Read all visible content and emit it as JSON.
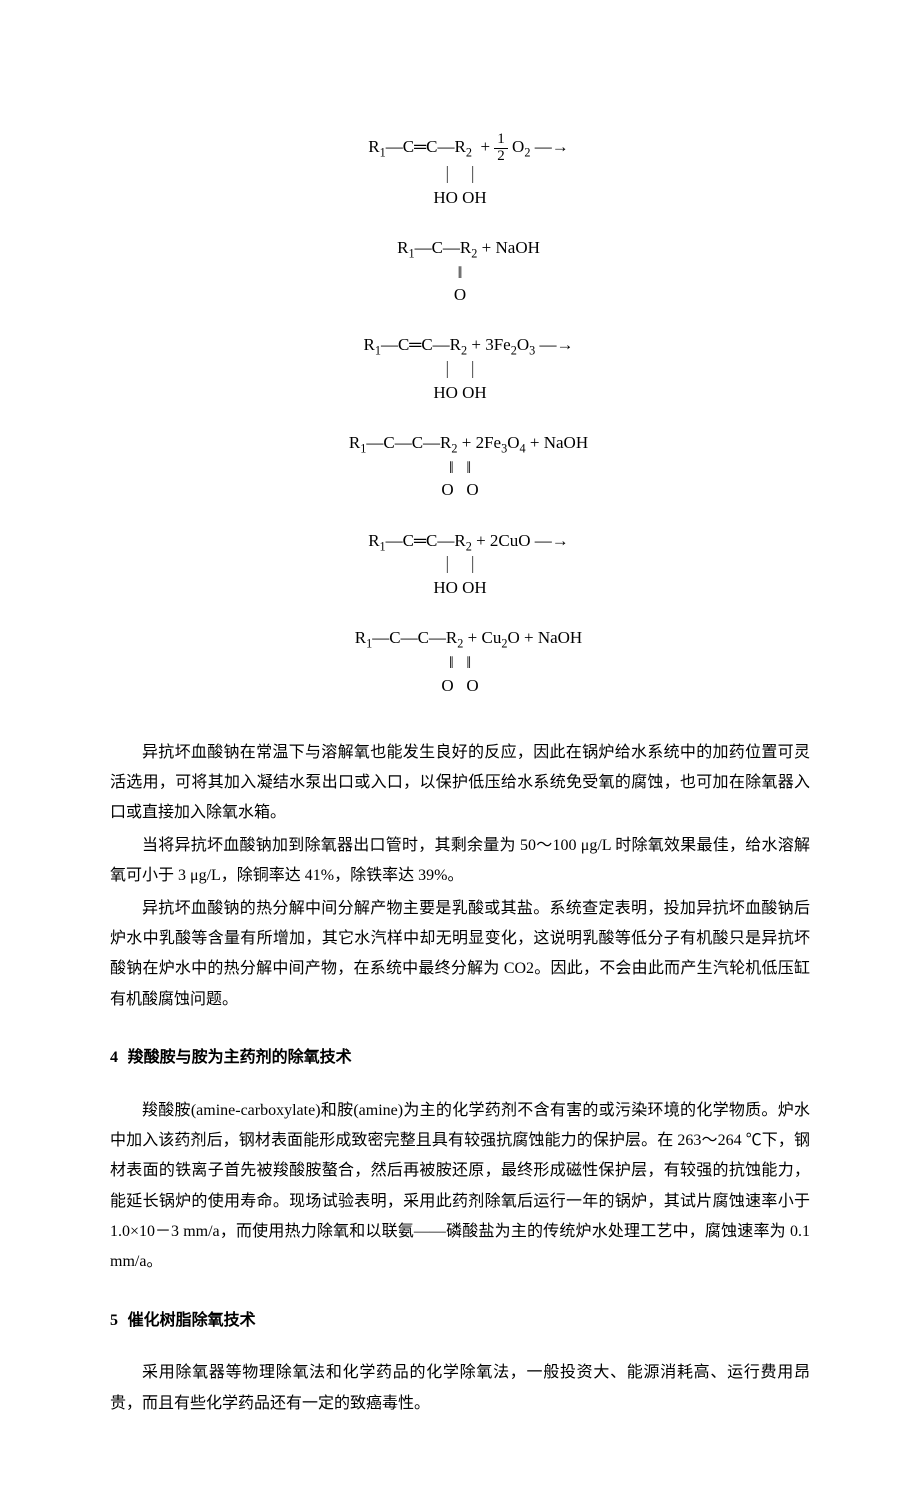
{
  "equations": [
    {
      "line1_left": "R<sub>1</sub>—C═C—R<sub>2</sub>",
      "line1_right": "O<sub>2</sub> —→",
      "use_half": true,
      "bonds": "｜  ｜",
      "below": "HO OH"
    },
    {
      "line1_left": "R<sub>1</sub>—C—R<sub>2</sub>",
      "line1_right": " + NaOH",
      "bonds": "‖",
      "below": "O"
    },
    {
      "line1_left": "R<sub>1</sub>—C═C—R<sub>2</sub>",
      "line1_right": " + 3Fe<sub>2</sub>O<sub>3</sub> —→",
      "bonds": "｜  ｜",
      "below": "HO OH"
    },
    {
      "line1_left": "R<sub>1</sub>—C—C—R<sub>2</sub>",
      "line1_right": " + 2Fe<sub>3</sub>O<sub>4</sub> + NaOH",
      "bonds": "‖   ‖",
      "below": "O   O"
    },
    {
      "line1_left": "R<sub>1</sub>—C═C—R<sub>2</sub>",
      "line1_right": " + 2CuO —→",
      "bonds": "｜  ｜",
      "below": "HO OH"
    },
    {
      "line1_left": "R<sub>1</sub>—C—C—R<sub>2</sub>",
      "line1_right": " + Cu<sub>2</sub>O + NaOH",
      "bonds": "‖   ‖",
      "below": "O   O"
    }
  ],
  "body": {
    "p1": "异抗坏血酸钠在常温下与溶解氧也能发生良好的反应，因此在锅炉给水系统中的加药位置可灵活选用，可将其加入凝结水泵出口或入口，以保护低压给水系统免受氧的腐蚀，也可加在除氧器入口或直接加入除氧水箱。",
    "p2": "当将异抗坏血酸钠加到除氧器出口管时，其剩余量为 50～100 μg/L 时除氧效果最佳，给水溶解氧可小于 3 μg/L，除铜率达 41%，除铁率达 39%。",
    "p3": "异抗坏血酸钠的热分解中间分解产物主要是乳酸或其盐。系统查定表明，投加异抗坏血酸钠后炉水中乳酸等含量有所增加，其它水汽样中却无明显变化，这说明乳酸等低分子有机酸只是异抗坏酸钠在炉水中的热分解中间产物，在系统中最终分解为 CO2。因此，不会由此而产生汽轮机低压缸有机酸腐蚀问题。"
  },
  "h4": {
    "num": "4",
    "title": "羧酸胺与胺为主药剂的除氧技术"
  },
  "sec4": {
    "p1": "羧酸胺(amine-carboxylate)和胺(amine)为主的化学药剂不含有害的或污染环境的化学物质。炉水中加入该药剂后，钢材表面能形成致密完整且具有较强抗腐蚀能力的保护层。在 263～264 ℃下，钢材表面的铁离子首先被羧酸胺螯合，然后再被胺还原，最终形成磁性保护层，有较强的抗蚀能力，能延长锅炉的使用寿命。现场试验表明，采用此药剂除氧后运行一年的锅炉，其试片腐蚀速率小于 1.0×10－3 mm/a，而使用热力除氧和以联氨——磷酸盐为主的传统炉水处理工艺中，腐蚀速率为 0.1 mm/a。"
  },
  "h5": {
    "num": "5",
    "title": "催化树脂除氧技术"
  },
  "sec5": {
    "p1": "采用除氧器等物理除氧法和化学药品的化学除氧法，一般投资大、能源消耗高、运行费用昂贵，而且有些化学药品还有一定的致癌毒性。"
  }
}
